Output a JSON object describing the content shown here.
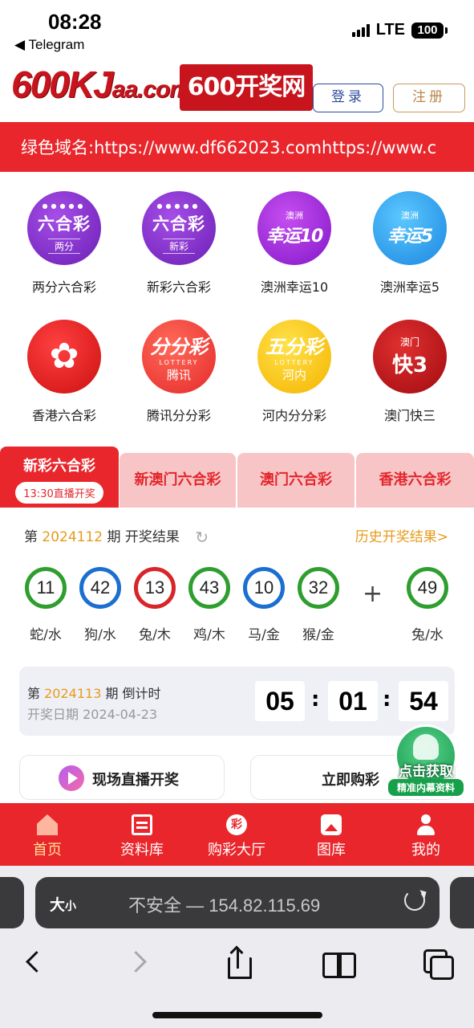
{
  "status_bar": {
    "time": "08:28",
    "back_app": "◀ Telegram",
    "network": "LTE",
    "battery": "100"
  },
  "header": {
    "logo_main": "600KJ",
    "logo_domain": "aa.com",
    "logo_cn": "600开奖网",
    "login_label": "登录",
    "register_label": "注册"
  },
  "marquee_text": "绿色域名:https://www.df662023.comhttps://www.c",
  "games": [
    {
      "name": "两分六合彩",
      "icon": "liuhecai-icon",
      "t1": "六合彩",
      "t2": "两分"
    },
    {
      "name": "新彩六合彩",
      "icon": "liuhecai-icon",
      "t1": "六合彩",
      "t2": "新彩"
    },
    {
      "name": "澳洲幸运10",
      "icon": "lucky10-icon",
      "t1": "澳洲",
      "t2": "幸运10"
    },
    {
      "name": "澳洲幸运5",
      "icon": "lucky5-icon",
      "t1": "澳洲",
      "t2": "幸运5"
    },
    {
      "name": "香港六合彩",
      "icon": "bauhinia-icon"
    },
    {
      "name": "腾讯分分彩",
      "icon": "fenfencai-icon",
      "t1": "分分彩",
      "t2": "LOTTERY",
      "t3": "腾讯"
    },
    {
      "name": "河内分分彩",
      "icon": "wufencai-icon",
      "t1": "五分彩",
      "t2": "LOTTERY",
      "t3": "河内"
    },
    {
      "name": "澳门快三",
      "icon": "kuai3-icon",
      "t1": "澳门",
      "t2": "快3"
    }
  ],
  "tabs": [
    {
      "label": "新彩六合彩",
      "badge": "13:30直播开奖"
    },
    {
      "label": "新澳门六合彩"
    },
    {
      "label": "澳门六合彩"
    },
    {
      "label": "香港六合彩"
    }
  ],
  "result": {
    "prefix": "第",
    "issue": "2024112",
    "suffix": "期 开奖结果",
    "history_link": "历史开奖结果>",
    "balls": [
      {
        "num": "11",
        "zodiac": "蛇/水",
        "color": "green"
      },
      {
        "num": "42",
        "zodiac": "狗/水",
        "color": "blue"
      },
      {
        "num": "13",
        "zodiac": "兔/木",
        "color": "red"
      },
      {
        "num": "43",
        "zodiac": "鸡/木",
        "color": "green"
      },
      {
        "num": "10",
        "zodiac": "马/金",
        "color": "blue"
      },
      {
        "num": "32",
        "zodiac": "猴/金",
        "color": "green"
      }
    ],
    "plus": "+",
    "special": {
      "num": "49",
      "zodiac": "兔/水",
      "color": "green"
    }
  },
  "countdown": {
    "prefix": "第",
    "issue": "2024113",
    "suffix": "期 倒计时",
    "date_label": "开奖日期",
    "date": "2024-04-23",
    "hh": "05",
    "mm": "01",
    "ss": "54"
  },
  "actions": {
    "live": "现场直播开奖",
    "buy": "立即购彩"
  },
  "float_badge": {
    "line1": "点击获取",
    "line2": "精准内幕资料"
  },
  "bottom_nav": [
    {
      "label": "首页",
      "icon": "home-icon",
      "active": true
    },
    {
      "label": "资料库",
      "icon": "document-icon"
    },
    {
      "label": "购彩大厅",
      "icon": "lottery-icon",
      "glyph": "彩"
    },
    {
      "label": "图库",
      "icon": "gallery-icon"
    },
    {
      "label": "我的",
      "icon": "user-icon"
    }
  ],
  "safari": {
    "text_size": "大",
    "text_size_small": "小",
    "url": "不安全 — 154.82.115.69"
  },
  "colors": {
    "primary_red": "#e8262b",
    "tab_pink": "#f8c5c6",
    "issue_orange": "#e89a1a",
    "ball_green": "#2e9e2e",
    "ball_blue": "#1a6fd0",
    "ball_red": "#d8252a"
  }
}
